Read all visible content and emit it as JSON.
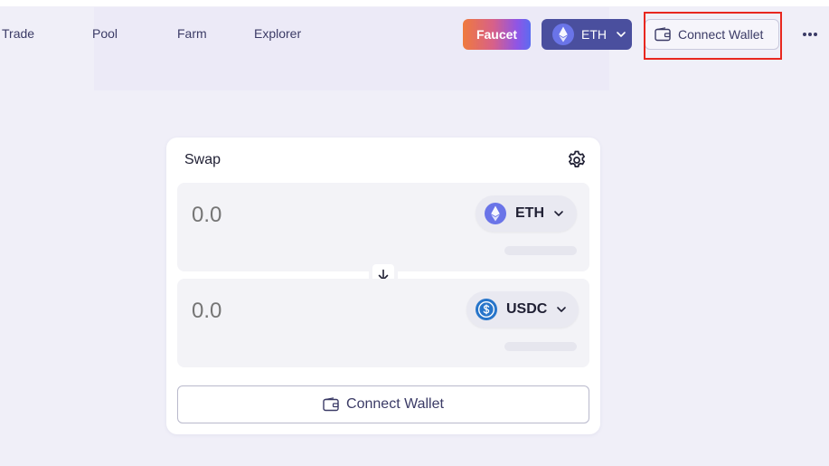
{
  "nav": {
    "items": [
      {
        "label": "Trade"
      },
      {
        "label": "Pool"
      },
      {
        "label": "Farm"
      },
      {
        "label": "Explorer"
      }
    ]
  },
  "header": {
    "faucet_label": "Faucet",
    "network": {
      "label": "ETH",
      "icon": "ethereum-icon"
    },
    "connect_wallet_label": "Connect Wallet",
    "more_icon": "more-dots-icon"
  },
  "swap": {
    "title": "Swap",
    "settings_icon": "gear-icon",
    "from": {
      "amount_placeholder": "0.0",
      "token": "ETH",
      "token_icon": "ethereum-icon"
    },
    "to": {
      "amount_placeholder": "0.0",
      "token": "USDC",
      "token_icon": "usdc-icon"
    },
    "switch_icon": "arrow-down-icon",
    "connect_wallet_label": "Connect Wallet"
  },
  "colors": {
    "accent": "#4a4f9e",
    "highlight": "#e8271f",
    "background": "#f0eff8"
  }
}
